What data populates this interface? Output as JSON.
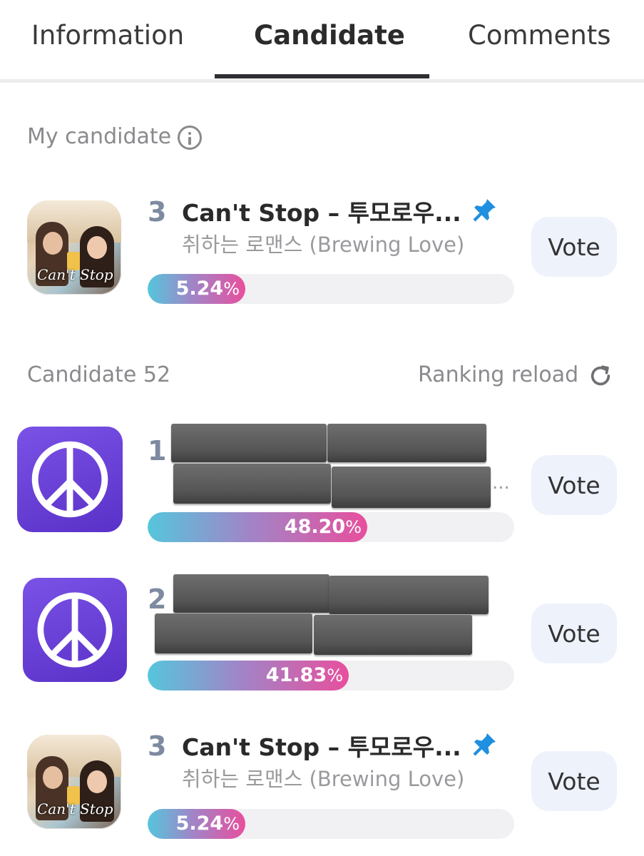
{
  "tabs": [
    {
      "label": "Information",
      "active": false
    },
    {
      "label": "Candidate",
      "active": true
    },
    {
      "label": "Comments",
      "active": false
    }
  ],
  "my_candidate": {
    "section_label": "My candidate",
    "rank": "3",
    "title": "Can't Stop – 투모로우...",
    "subtitle": "취하는 로맨스 (Brewing Love)",
    "percent_value": "5.24",
    "percent_sign": "%",
    "percent": 5.24,
    "vote_label": "Vote",
    "thumbnail_text": "Can't Stop",
    "pinned": true
  },
  "candidates_header": {
    "count_label": "Candidate 52",
    "reload_label": "Ranking reload"
  },
  "candidates": [
    {
      "rank": "1",
      "title": "",
      "subtitle": "",
      "ellipsis": "...",
      "percent_value": "48.20",
      "percent_sign": "%",
      "percent": 48.2,
      "vote_label": "Vote",
      "redacted": true,
      "thumbnail": "peace-icon"
    },
    {
      "rank": "2",
      "title": "",
      "subtitle": "",
      "percent_value": "41.83",
      "percent_sign": "%",
      "percent": 41.83,
      "vote_label": "Vote",
      "redacted": true,
      "thumbnail": "peace-icon"
    },
    {
      "rank": "3",
      "title": "Can't Stop – 투모로우...",
      "subtitle": "취하는 로맨스 (Brewing Love)",
      "percent_value": "5.24",
      "percent_sign": "%",
      "percent": 5.24,
      "vote_label": "Vote",
      "redacted": false,
      "thumbnail": "album-cover",
      "thumbnail_text": "Can't Stop",
      "pinned": true
    }
  ],
  "colors": {
    "bar_start": "#55c6dc",
    "bar_end": "#e84f9d",
    "vote_bg": "#eef2fb",
    "rank": "#7d8aa0",
    "pin": "#1f8fe0",
    "peace_bg": "#6a40d8"
  },
  "icons": [
    "info-icon",
    "reload-icon",
    "pin-icon",
    "peace-icon"
  ]
}
